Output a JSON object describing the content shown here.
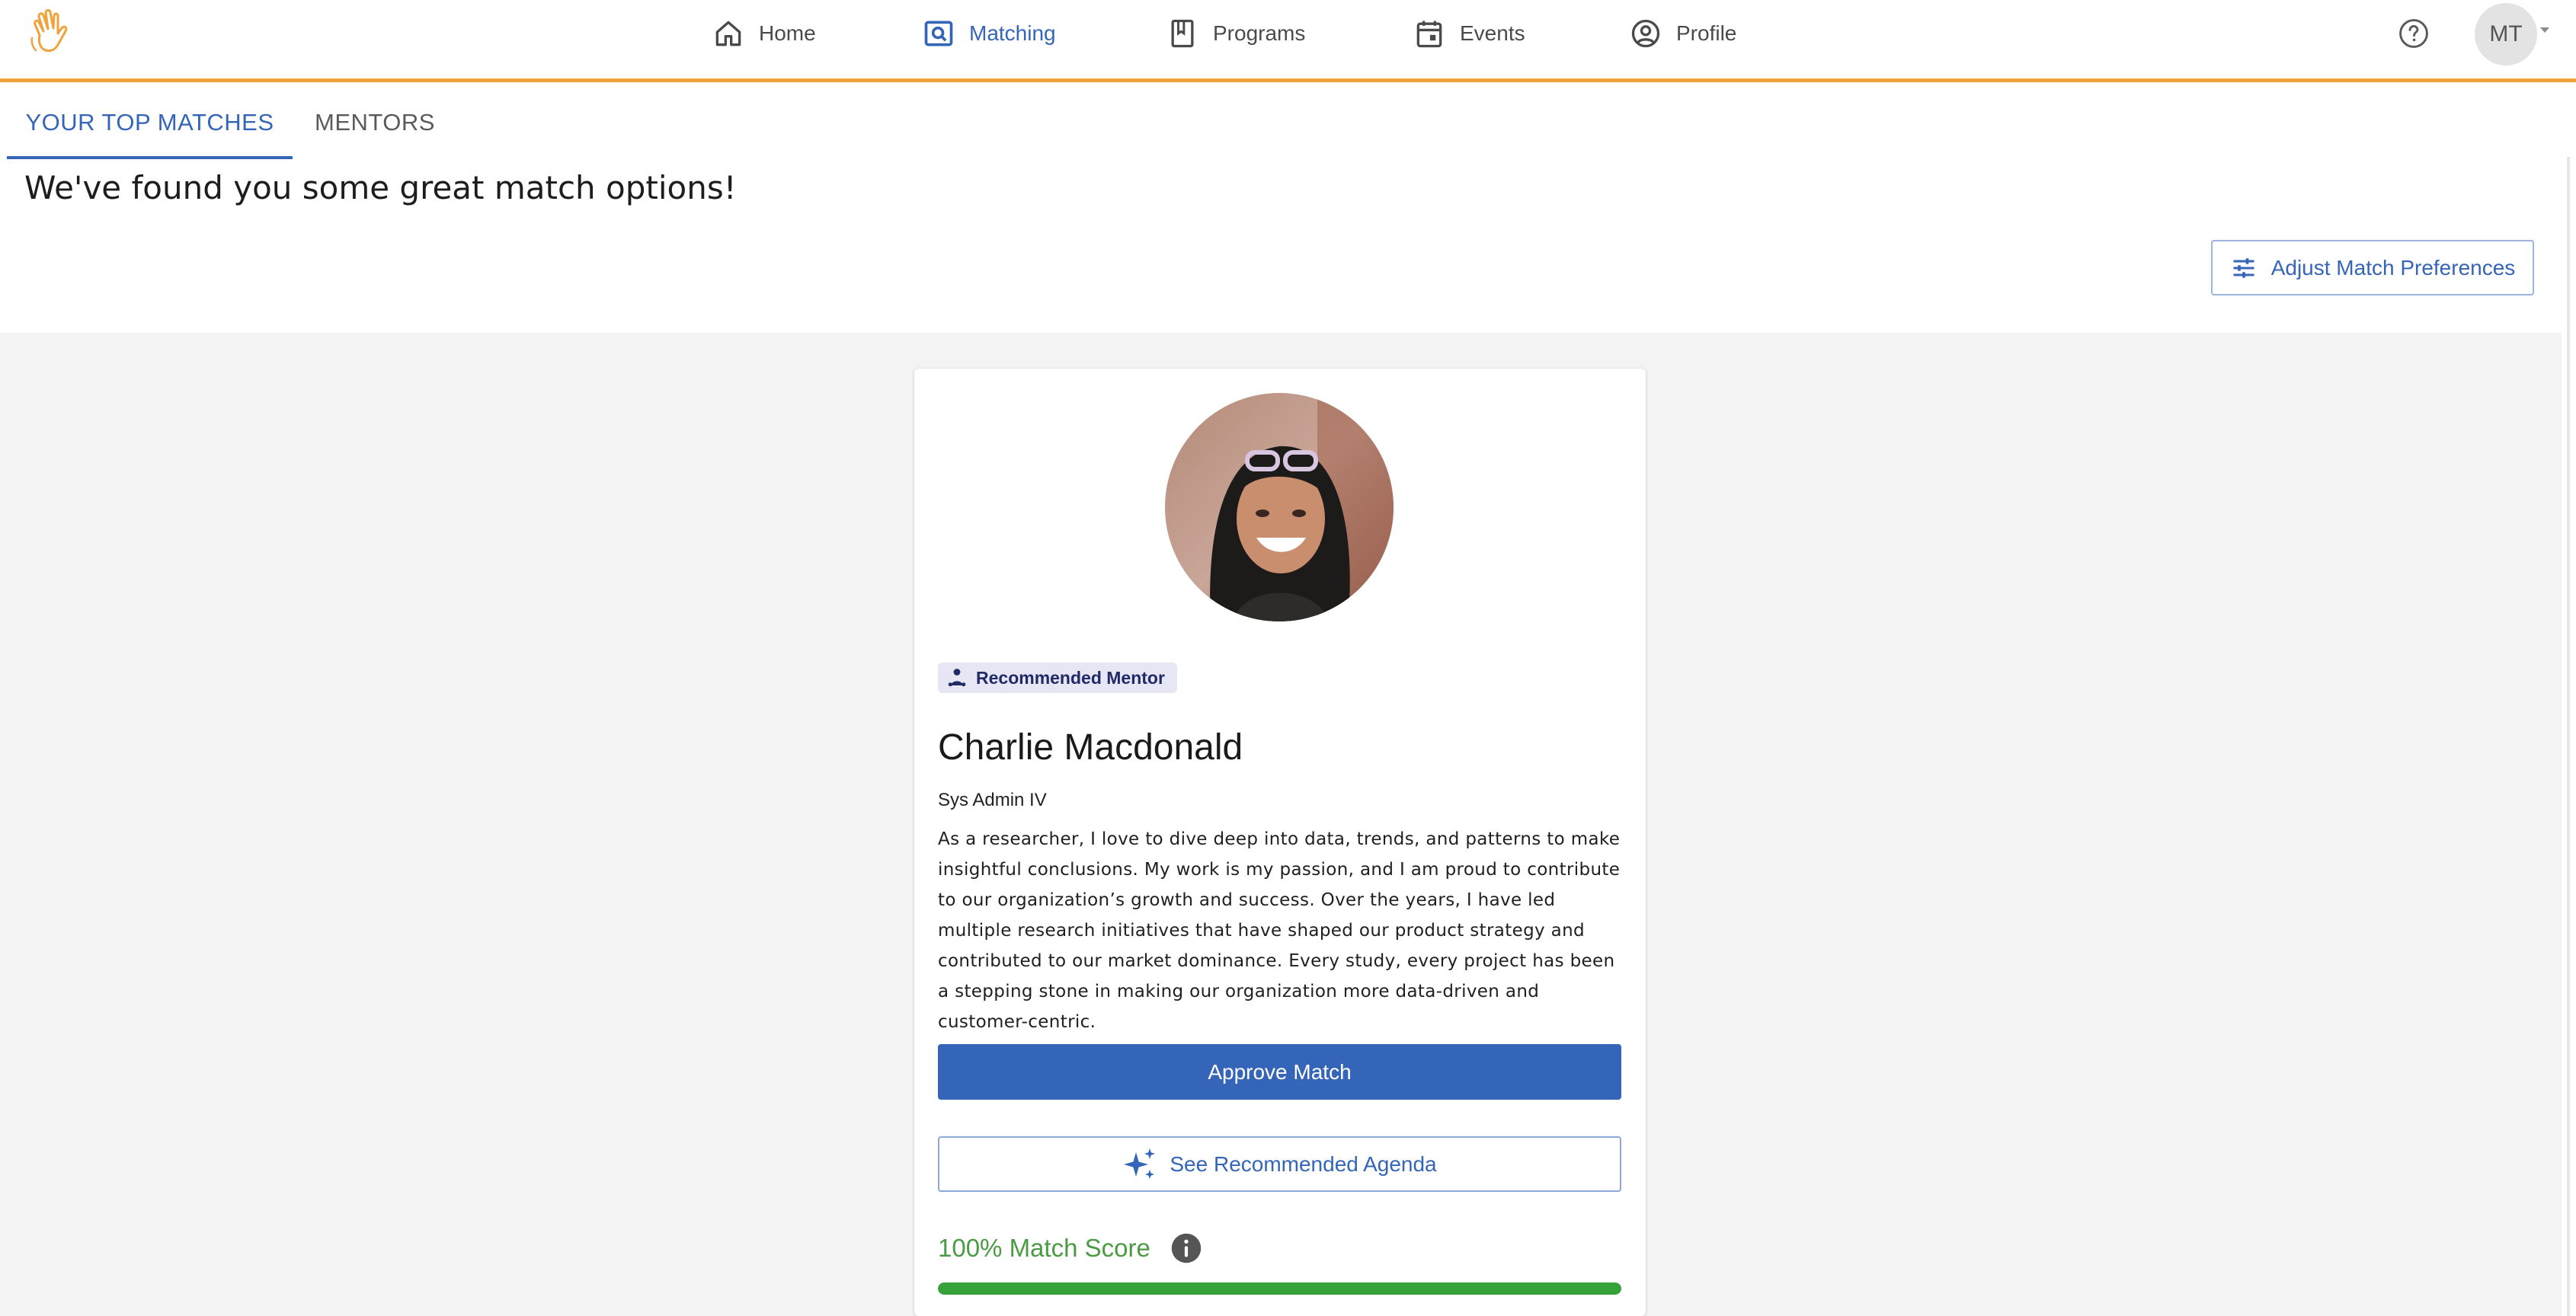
{
  "nav": {
    "items": [
      {
        "label": "Home",
        "icon": "home-icon"
      },
      {
        "label": "Matching",
        "icon": "matching-icon",
        "active": true
      },
      {
        "label": "Programs",
        "icon": "programs-icon"
      },
      {
        "label": "Events",
        "icon": "events-icon"
      },
      {
        "label": "Profile",
        "icon": "profile-icon"
      }
    ],
    "user_initials": "MT",
    "accent_color": "#f0a23b",
    "active_color": "#3565b9"
  },
  "tabs": [
    {
      "label": "YOUR TOP MATCHES",
      "active": true
    },
    {
      "label": "MENTORS",
      "active": false
    }
  ],
  "header": {
    "headline": "We've found you some great match options!",
    "adjust_label": "Adjust Match Preferences"
  },
  "match_card": {
    "badge": "Recommended Mentor",
    "name": "Charlie Macdonald",
    "role": "Sys Admin IV",
    "bio": "As a researcher, I love to dive deep into data, trends, and patterns to make insightful conclusions. My work is my passion, and I am proud to contribute to our organization’s growth and success. Over the years, I have led multiple research initiatives that have shaped our product strategy and contributed to our market dominance. Every study, every project has been a stepping stone in making our organization more data-driven and customer-centric.",
    "approve_label": "Approve Match",
    "agenda_label": "See Recommended Agenda",
    "score_label": "100% Match Score",
    "score_fraction": 1.0,
    "score_color": "#36a23a"
  }
}
